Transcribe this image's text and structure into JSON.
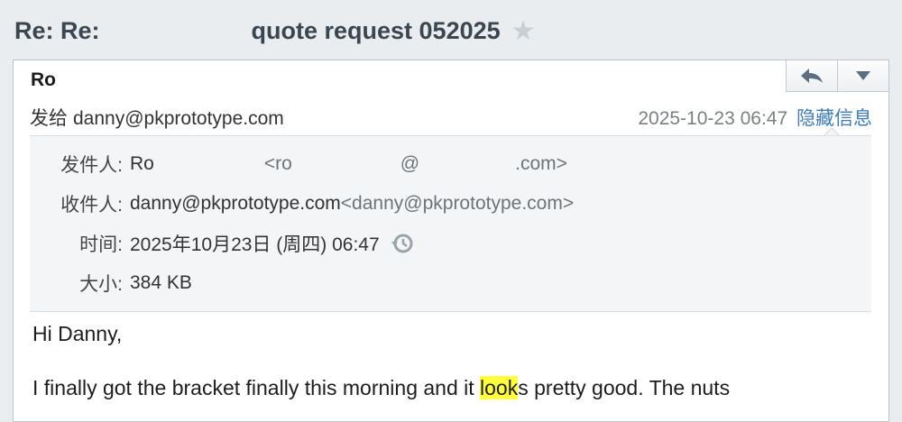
{
  "subject": {
    "prefix": "Re: Re:",
    "title": "quote request 052025"
  },
  "message": {
    "sender_name": "Ro",
    "to_label": "发给",
    "to_address": "danny@pkprototype.com",
    "date": "2025-10-23 06:47",
    "hide_info_link": "隐藏信息",
    "reply_icon": "reply-icon",
    "more_icon": "chevron-down-icon"
  },
  "details": {
    "from_label": "发件人:",
    "from_name": "Ro",
    "from_email_start": "<ro",
    "from_email_at": "@",
    "from_email_end": ".com>",
    "recipient_label": "收件人:",
    "recipient_name": "danny@pkprototype.com",
    "recipient_email": "<danny@pkprototype.com>",
    "time_label": "时间:",
    "time_value": "2025年10月23日 (周四) 06:47",
    "size_label": "大小:",
    "size_value": "384 KB"
  },
  "body": {
    "greeting": "Hi Danny,",
    "line1_before": "I finally got the bracket finally this morning and it ",
    "line1_highlight": "look",
    "line1_after": "s pretty good. The nuts"
  }
}
